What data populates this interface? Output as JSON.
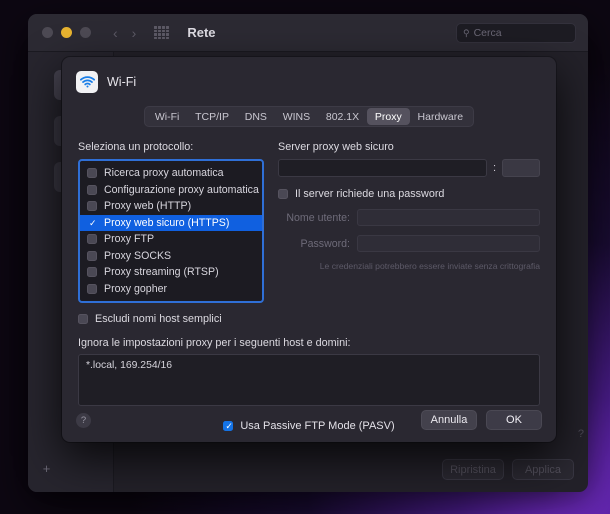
{
  "window": {
    "title": "Rete",
    "traffic_lights": [
      "close-red",
      "minimize-yellow",
      "zoom-green"
    ],
    "nav_back": "‹",
    "nav_forward": "›",
    "search_placeholder": "Cerca",
    "search_icon": "search-icon",
    "grid_icon": "grid-view-icon",
    "add_service_label": "+",
    "help_corner_label": "?",
    "footer_buttons": [
      {
        "label": "Ripristina",
        "enabled": false
      },
      {
        "label": "Applica",
        "enabled": false
      }
    ],
    "sidebar_services": [
      {
        "icon": "wifi-icon",
        "selected": true
      },
      {
        "icon": "ethernet-icon",
        "selected": false
      },
      {
        "icon": "ethernet-icon",
        "selected": false
      }
    ]
  },
  "sheet": {
    "title": "Wi-Fi",
    "icon": "wifi-icon",
    "tabs": [
      {
        "label": "Wi-Fi",
        "active": false
      },
      {
        "label": "TCP/IP",
        "active": false
      },
      {
        "label": "DNS",
        "active": false
      },
      {
        "label": "WINS",
        "active": false
      },
      {
        "label": "802.1X",
        "active": false
      },
      {
        "label": "Proxy",
        "active": true
      },
      {
        "label": "Hardware",
        "active": false
      }
    ],
    "protocols": {
      "label": "Seleziona un protocollo:",
      "items": [
        {
          "label": "Ricerca proxy automatica",
          "checked": false,
          "selected": false
        },
        {
          "label": "Configurazione proxy automatica",
          "checked": false,
          "selected": false
        },
        {
          "label": "Proxy web (HTTP)",
          "checked": false,
          "selected": false
        },
        {
          "label": "Proxy web sicuro (HTTPS)",
          "checked": true,
          "selected": true
        },
        {
          "label": "Proxy FTP",
          "checked": false,
          "selected": false
        },
        {
          "label": "Proxy SOCKS",
          "checked": false,
          "selected": false
        },
        {
          "label": "Proxy streaming (RTSP)",
          "checked": false,
          "selected": false
        },
        {
          "label": "Proxy gopher",
          "checked": false,
          "selected": false
        }
      ]
    },
    "exclude_simple_hosts": {
      "label": "Escludi nomi host semplici",
      "checked": false
    },
    "server_panel": {
      "title": "Server proxy web sicuro",
      "host_value": "",
      "separator": ":",
      "port_value": "",
      "requires_password": {
        "label": "Il server richiede una password",
        "checked": false
      },
      "username_label": "Nome utente:",
      "username_value": "",
      "password_label": "Password:",
      "password_value": "",
      "note": "Le credenziali potrebbero essere inviate senza crittografia"
    },
    "bypass": {
      "label": "Ignora le impostazioni proxy per i seguenti host e domini:",
      "value": "*.local, 169.254/16"
    },
    "pasv": {
      "label": "Usa Passive FTP Mode (PASV)",
      "checked": true
    },
    "help_label": "?",
    "buttons": {
      "cancel": "Annulla",
      "ok": "OK"
    }
  },
  "colors": {
    "accent_blue": "#1060e0",
    "focus_ring": "#2f6fd6",
    "checkbox_blue": "#1473e6",
    "yellow_light": "#e8b430"
  }
}
